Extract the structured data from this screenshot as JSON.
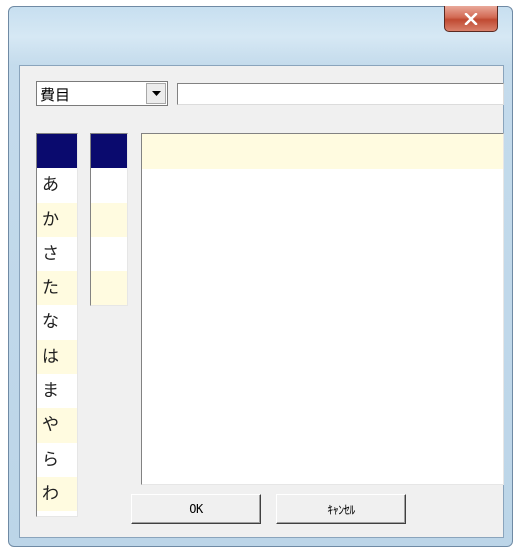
{
  "window": {
    "close_icon": "close-x-icon",
    "colors": {
      "close_button": "#c85a45",
      "selection": "#0a0a6e",
      "row_alt": "#fffbe0"
    }
  },
  "filter": {
    "combo_value": "費目",
    "text_value": ""
  },
  "kana_list": {
    "items": [
      "",
      "あ",
      "か",
      "さ",
      "た",
      "な",
      "は",
      "ま",
      "や",
      "ら",
      "わ"
    ],
    "selected_index": 0
  },
  "buttons": {
    "ok_label": "OK",
    "cancel_label": "ｷｬﾝｾﾙ"
  }
}
